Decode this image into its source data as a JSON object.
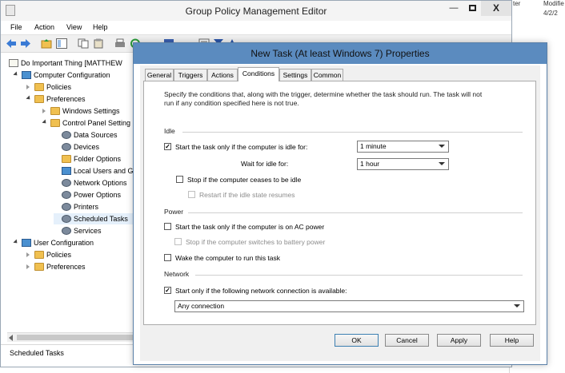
{
  "background": {
    "col_headers": [
      "ter",
      "Modifie"
    ],
    "col_value": "4/2/2"
  },
  "window": {
    "title": "Group Policy Management Editor",
    "min_glyph": "—",
    "close_glyph": "X"
  },
  "menu": [
    "File",
    "Action",
    "View",
    "Help"
  ],
  "tree": {
    "root": "Do Important Thing [MATTHEW",
    "computer_config": "Computer Configuration",
    "policies": "Policies",
    "preferences": "Preferences",
    "windows_settings": "Windows Settings",
    "control_panel_settings": "Control Panel Setting",
    "data_sources": "Data Sources",
    "devices": "Devices",
    "folder_options": "Folder Options",
    "local_users": "Local Users and G",
    "network_options": "Network Options",
    "power_options": "Power Options",
    "printers": "Printers",
    "scheduled_tasks": "Scheduled Tasks",
    "services": "Services",
    "user_config": "User Configuration",
    "user_policies": "Policies",
    "user_preferences": "Preferences"
  },
  "status": "Scheduled Tasks",
  "dialog": {
    "title": "New Task (At least Windows 7) Properties",
    "tabs": [
      "General",
      "Triggers",
      "Actions",
      "Conditions",
      "Settings",
      "Common"
    ],
    "active_tab": "Conditions",
    "intro_line1": "Specify the conditions that, along with the trigger, determine whether the task should run.  The task will not",
    "intro_line2": "run if any condition specified here is not true.",
    "idle": {
      "section": "Idle",
      "start_if_idle_label": "Start the task only if the computer is idle for:",
      "start_if_idle_checked": true,
      "idle_duration": "1 minute",
      "wait_label": "Wait for idle for:",
      "wait_value": "1 hour",
      "stop_if_ceases_label": "Stop if the computer ceases to be idle",
      "stop_if_ceases_checked": false,
      "restart_label": "Restart if the idle state resumes",
      "restart_checked": false
    },
    "power": {
      "section": "Power",
      "ac_power_label": "Start the task only if the computer is on AC power",
      "ac_power_checked": false,
      "battery_label": "Stop if the computer switches to battery power",
      "battery_checked": false,
      "wake_label": "Wake the computer to run this task",
      "wake_checked": false
    },
    "network": {
      "section": "Network",
      "network_label": "Start only if the following network connection is available:",
      "network_checked": true,
      "connection": "Any connection"
    },
    "buttons": {
      "ok": "OK",
      "cancel": "Cancel",
      "apply": "Apply",
      "help": "Help"
    }
  },
  "check_glyph": "✓"
}
